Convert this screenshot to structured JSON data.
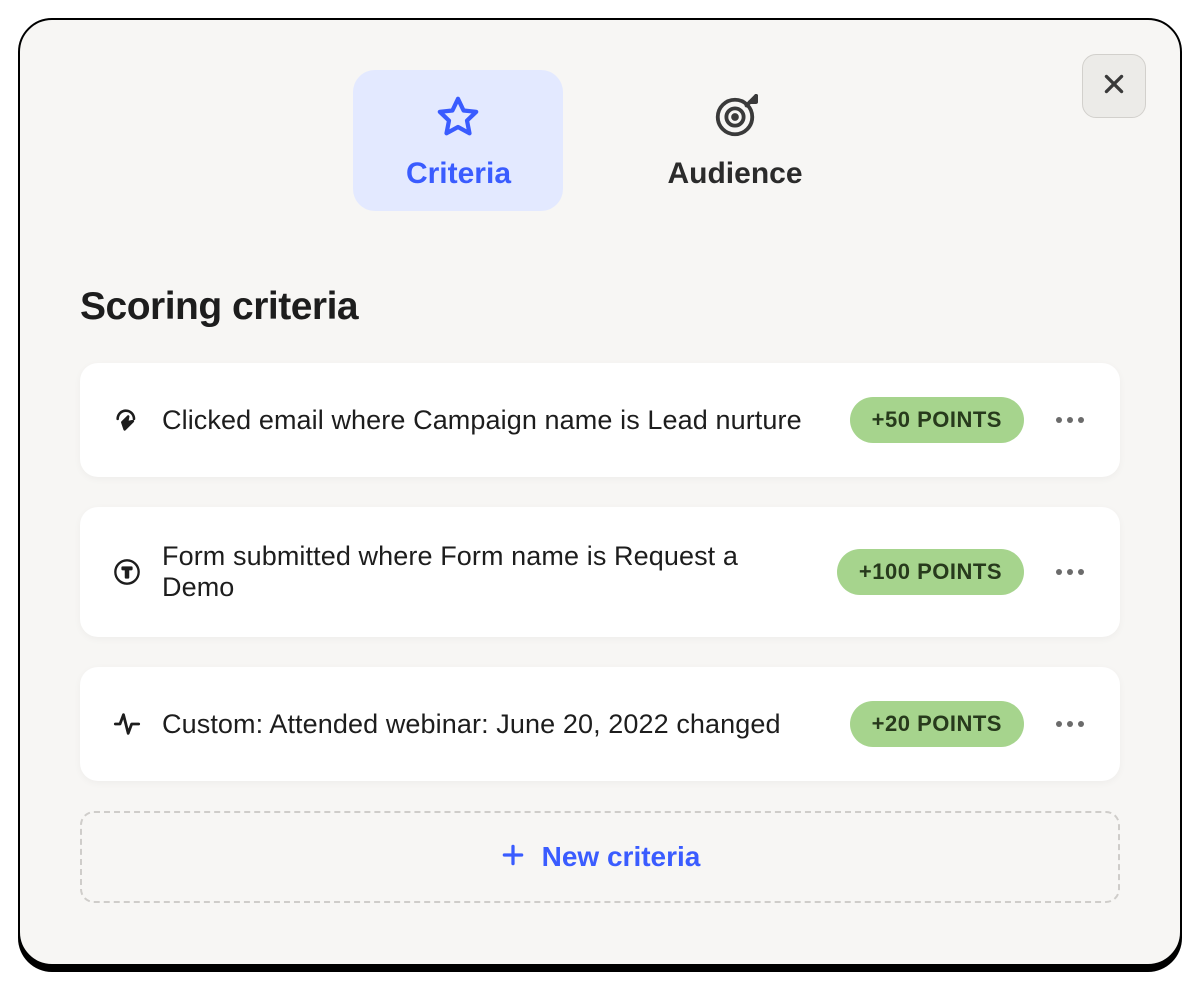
{
  "tabs": {
    "criteria_label": "Criteria",
    "audience_label": "Audience"
  },
  "section_title": "Scoring criteria",
  "criteria": [
    {
      "icon": "click",
      "text": "Clicked email where Campaign name is Lead nurture",
      "points": "+50 POINTS"
    },
    {
      "icon": "form",
      "text": "Form submitted where Form name is Request a Demo",
      "points": "+100 POINTS"
    },
    {
      "icon": "pulse",
      "text": "Custom: Attended webinar: June 20, 2022 changed",
      "points": "+20 POINTS"
    }
  ],
  "new_criteria_label": "New criteria"
}
